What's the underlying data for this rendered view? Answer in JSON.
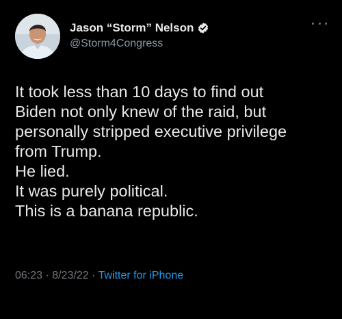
{
  "author": {
    "display_name": "Jason “Storm” Nelson",
    "handle": "@Storm4Congress",
    "verified_icon": "verified-badge-icon"
  },
  "tweet": {
    "lines": [
      "It took less than 10 days to find out",
      "Biden not only knew of the raid, but",
      "personally stripped executive privilege",
      "from Trump.",
      "He lied.",
      "It was purely political.",
      "This is a banana republic."
    ]
  },
  "meta": {
    "time": "06:23",
    "separator": "·",
    "date": "8/23/22",
    "source": "Twitter for iPhone"
  },
  "colors": {
    "background": "#000000",
    "text": "#e7e9ea",
    "secondary": "#71767b",
    "link": "#1d9bf0"
  }
}
